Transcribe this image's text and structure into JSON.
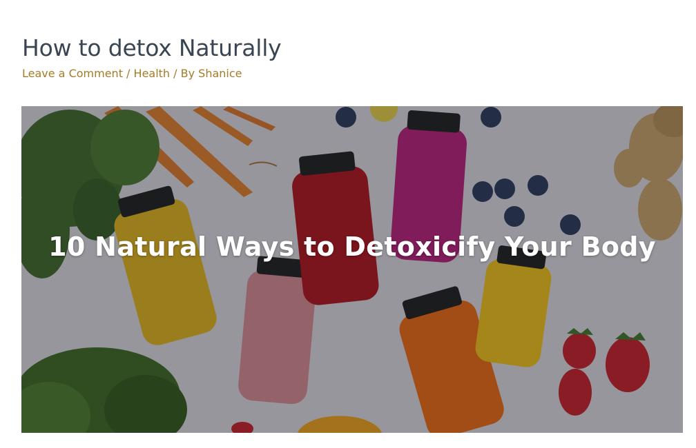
{
  "post": {
    "title": "How to detox Naturally",
    "meta": {
      "comment_link": "Leave a Comment",
      "separator1": " / ",
      "category": "Health",
      "separator2": " / By ",
      "author": "Shanice"
    }
  },
  "featured_image": {
    "caption": "10 Natural Ways to Detoxicify Your Body",
    "colors": {
      "background": "#d9d8dc",
      "carrot": "#e07a2a",
      "greens": "#3f6b2a",
      "ginger": "#c9a36b",
      "blueberry": "#2d3a5c",
      "strawberry": "#c8202a",
      "cap": "#1f1f1f",
      "juice_yellow": "#e2b41c",
      "juice_pink": "#d98a92",
      "juice_red": "#b3141e",
      "juice_magenta": "#b8207a",
      "juice_orange": "#ee6a12",
      "juice_lemon": "#f2c21a"
    }
  }
}
